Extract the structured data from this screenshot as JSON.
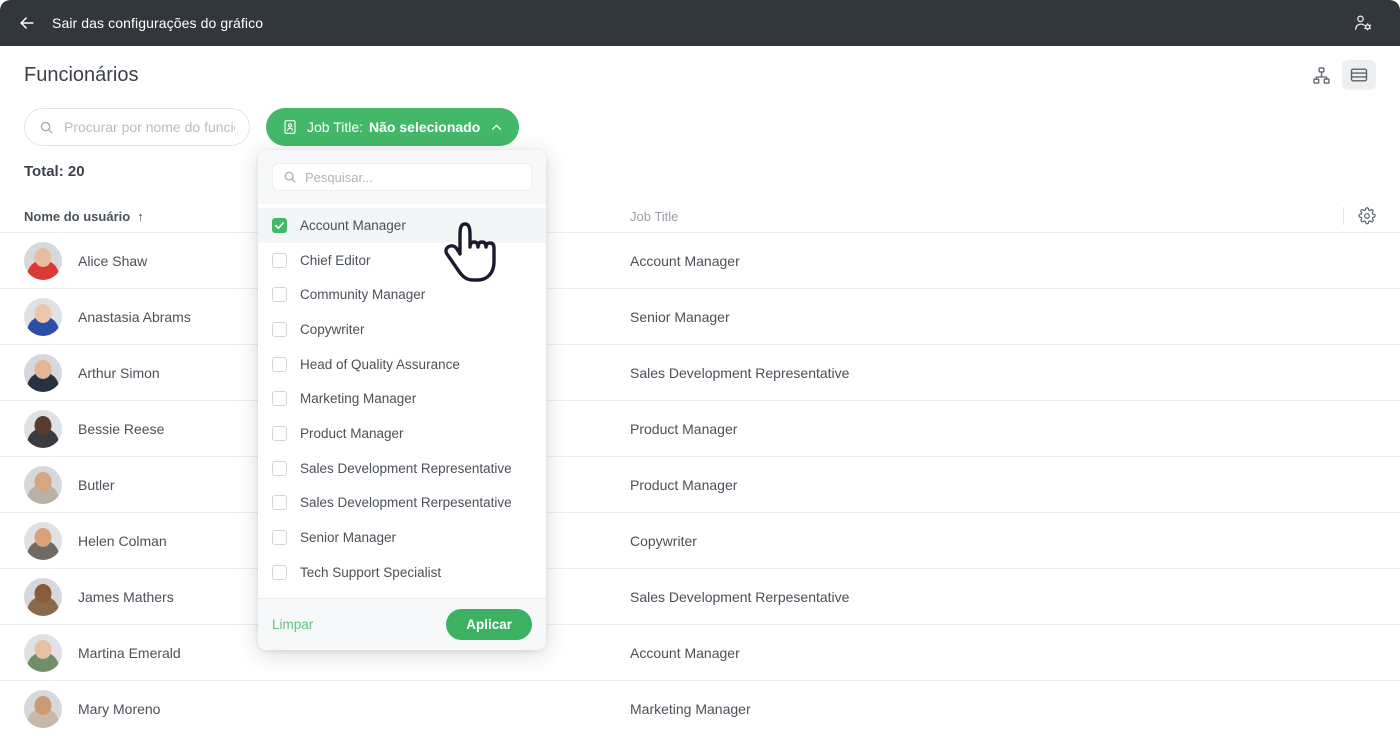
{
  "topbar": {
    "back_label": "Sair das configurações do gráfico",
    "back_icon": "arrow-left-icon",
    "user_settings_icon": "user-settings-icon"
  },
  "header": {
    "title": "Funcionários",
    "views": [
      {
        "name": "org-chart-view",
        "icon": "org-chart-icon",
        "active": false
      },
      {
        "name": "list-view",
        "icon": "list-rows-icon",
        "active": true
      }
    ]
  },
  "toolbar": {
    "search": {
      "placeholder": "Procurar por nome do funcionário",
      "value": "",
      "icon": "search-icon"
    },
    "filter": {
      "icon": "badge-id-icon",
      "label": "Job Title:",
      "value": "Não selecionado",
      "caret_icon": "chevron-up-icon"
    }
  },
  "summary": {
    "total": "Total: 20"
  },
  "table": {
    "columns": {
      "name": "Nome do usuário",
      "sort_indicator": "↑",
      "job": "Job Title"
    },
    "settings_icon": "gear-icon",
    "rows": [
      {
        "name": "Alice Shaw",
        "job": "Account Manager",
        "skin": "#e8bda2",
        "hair": "#3a2b25",
        "shirt": "#d93b34"
      },
      {
        "name": "Anastasia Abrams",
        "job": "Senior Manager",
        "skin": "#edc5ab",
        "hair": "#6b4630",
        "shirt": "#2b4fa8"
      },
      {
        "name": "Arthur Simon",
        "job": "Sales Development Representative",
        "skin": "#e3b795",
        "hair": "#5b4634",
        "shirt": "#263243"
      },
      {
        "name": "Bessie Reese",
        "job": "Product Manager",
        "skin": "#5a3c2d",
        "hair": "#2a1a14",
        "shirt": "#3b3b3f"
      },
      {
        "name": "Butler",
        "job": "Product Manager",
        "skin": "#d8a57f",
        "hair": "#241713",
        "shirt": "#b9b0a6"
      },
      {
        "name": "Helen Colman",
        "job": "Copywriter",
        "skin": "#d9a279",
        "hair": "#3b2a22",
        "shirt": "#6f6a64"
      },
      {
        "name": "James Mathers",
        "job": "Sales Development Rerpesentative",
        "skin": "#8a5a3b",
        "hair": "#2b1c14",
        "shirt": "#8a6a4a"
      },
      {
        "name": "Martina Emerald",
        "job": "Account Manager",
        "skin": "#e8c0a4",
        "hair": "#4a3528",
        "shirt": "#6f8f6a"
      },
      {
        "name": "Mary Moreno",
        "job": "Marketing Manager",
        "skin": "#cf9a72",
        "hair": "#231712",
        "shirt": "#c9b7a8"
      }
    ]
  },
  "dropdown": {
    "search": {
      "placeholder": "Pesquisar...",
      "value": "",
      "icon": "search-icon"
    },
    "options": [
      {
        "label": "Account Manager",
        "checked": true,
        "highlighted": true
      },
      {
        "label": "Chief Editor",
        "checked": false,
        "highlighted": false
      },
      {
        "label": "Community Manager",
        "checked": false,
        "highlighted": false
      },
      {
        "label": "Copywriter",
        "checked": false,
        "highlighted": false
      },
      {
        "label": "Head of Quality Assurance",
        "checked": false,
        "highlighted": false
      },
      {
        "label": "Marketing Manager",
        "checked": false,
        "highlighted": false
      },
      {
        "label": "Product Manager",
        "checked": false,
        "highlighted": false
      },
      {
        "label": "Sales Development Representative",
        "checked": false,
        "highlighted": false
      },
      {
        "label": "Sales Development Rerpesentative",
        "checked": false,
        "highlighted": false
      },
      {
        "label": "Senior Manager",
        "checked": false,
        "highlighted": false
      },
      {
        "label": "Tech Support Specialist",
        "checked": false,
        "highlighted": false
      }
    ],
    "clear_label": "Limpar",
    "apply_label": "Aplicar"
  },
  "cursor": {
    "icon": "pointing-hand-cursor"
  },
  "colors": {
    "accent_green": "#44b869",
    "apply_green": "#3cb162",
    "clear_green": "#5fc482",
    "topbar_dark": "#31373c",
    "text": "#4a5159",
    "muted": "#9aa0a8",
    "border": "#eceef0"
  }
}
